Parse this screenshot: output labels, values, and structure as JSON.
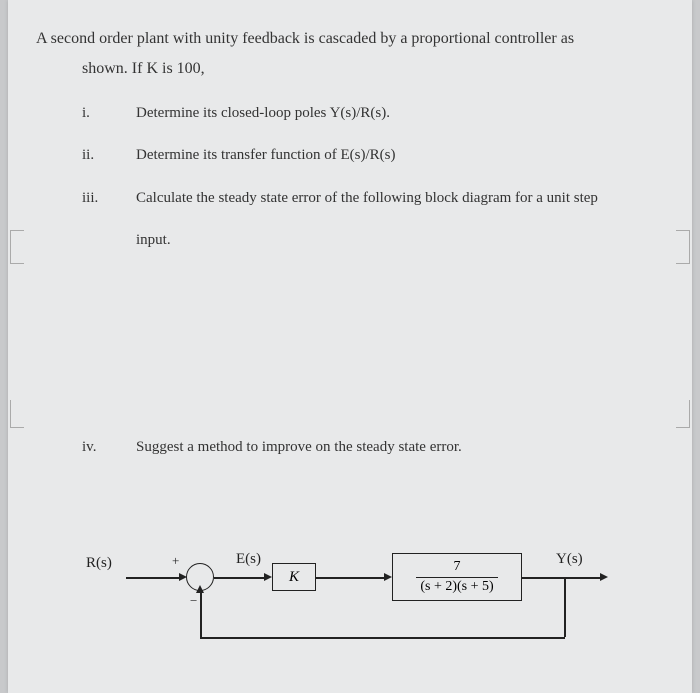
{
  "intro_line1": "A second order plant with unity feedback is cascaded by a proportional controller as",
  "intro_line2": "shown. If K is 100,",
  "items": [
    {
      "num": "i.",
      "text": "Determine its closed-loop poles Y(s)/R(s)."
    },
    {
      "num": "ii.",
      "text": "Determine its transfer function of E(s)/R(s)"
    },
    {
      "num": "iii.",
      "text": "Calculate the steady state error of the following block diagram for a unit step"
    },
    {
      "num": "",
      "text": "input."
    }
  ],
  "item_iv": {
    "num": "iv.",
    "text": "Suggest a method to improve on the steady state error."
  },
  "diagram": {
    "R": "R(s)",
    "plus": "+",
    "minus": "−",
    "E": "E(s)",
    "K": "K",
    "plant_num": "7",
    "plant_den": "(s + 2)(s + 5)",
    "Y": "Y(s)"
  }
}
